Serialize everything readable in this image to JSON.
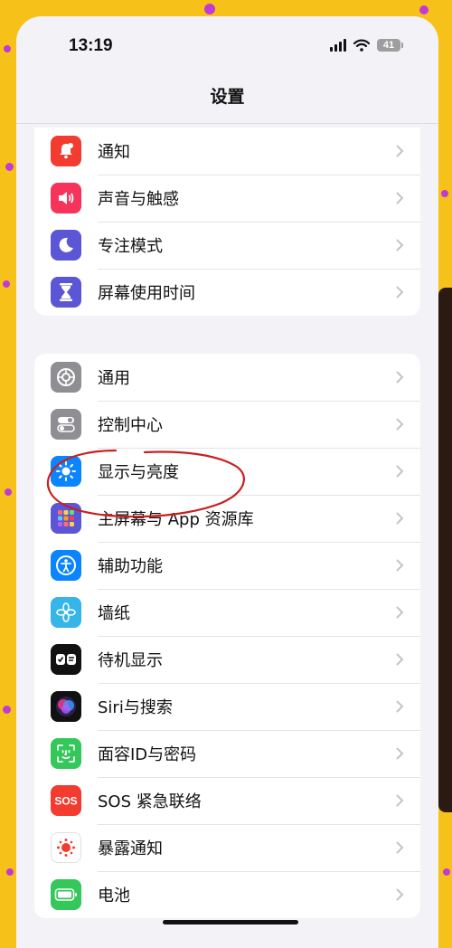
{
  "status_bar": {
    "time": "13:19",
    "battery_level": "41"
  },
  "nav": {
    "title": "设置"
  },
  "group1": [
    {
      "label": "通知",
      "icon": "bell-icon",
      "color": "#f33b30"
    },
    {
      "label": "声音与触感",
      "icon": "speaker-icon",
      "color": "#f6335a"
    },
    {
      "label": "专注模式",
      "icon": "moon-icon",
      "color": "#5a56d6"
    },
    {
      "label": "屏幕使用时间",
      "icon": "hourglass-icon",
      "color": "#5a56d6"
    }
  ],
  "group2": [
    {
      "label": "通用",
      "icon": "gear-icon",
      "color": "#8e8e93"
    },
    {
      "label": "控制中心",
      "icon": "toggles-icon",
      "color": "#8e8e93"
    },
    {
      "label": "显示与亮度",
      "icon": "sun-icon",
      "color": "#0a84ff"
    },
    {
      "label": "主屏幕与 App 资源库",
      "icon": "home-grid-icon",
      "color": "#5a56d6"
    },
    {
      "label": "辅助功能",
      "icon": "accessibility-icon",
      "color": "#0a84ff"
    },
    {
      "label": "墙纸",
      "icon": "flower-icon",
      "color": "#36b5e8"
    },
    {
      "label": "待机显示",
      "icon": "standby-icon",
      "color": "#111111"
    },
    {
      "label": "Siri与搜索",
      "icon": "siri-icon",
      "color": "#111111"
    },
    {
      "label": "面容ID与密码",
      "icon": "faceid-icon",
      "color": "#34c759"
    },
    {
      "label": "SOS 紧急联络",
      "icon": "sos-icon",
      "color": "#f33b30"
    },
    {
      "label": "暴露通知",
      "icon": "exposure-icon",
      "color": "#ffffff"
    },
    {
      "label": "电池",
      "icon": "battery-icon",
      "color": "#34c759"
    }
  ],
  "colors": {
    "background": "#f6c21a",
    "annotation": "#c8201e"
  }
}
